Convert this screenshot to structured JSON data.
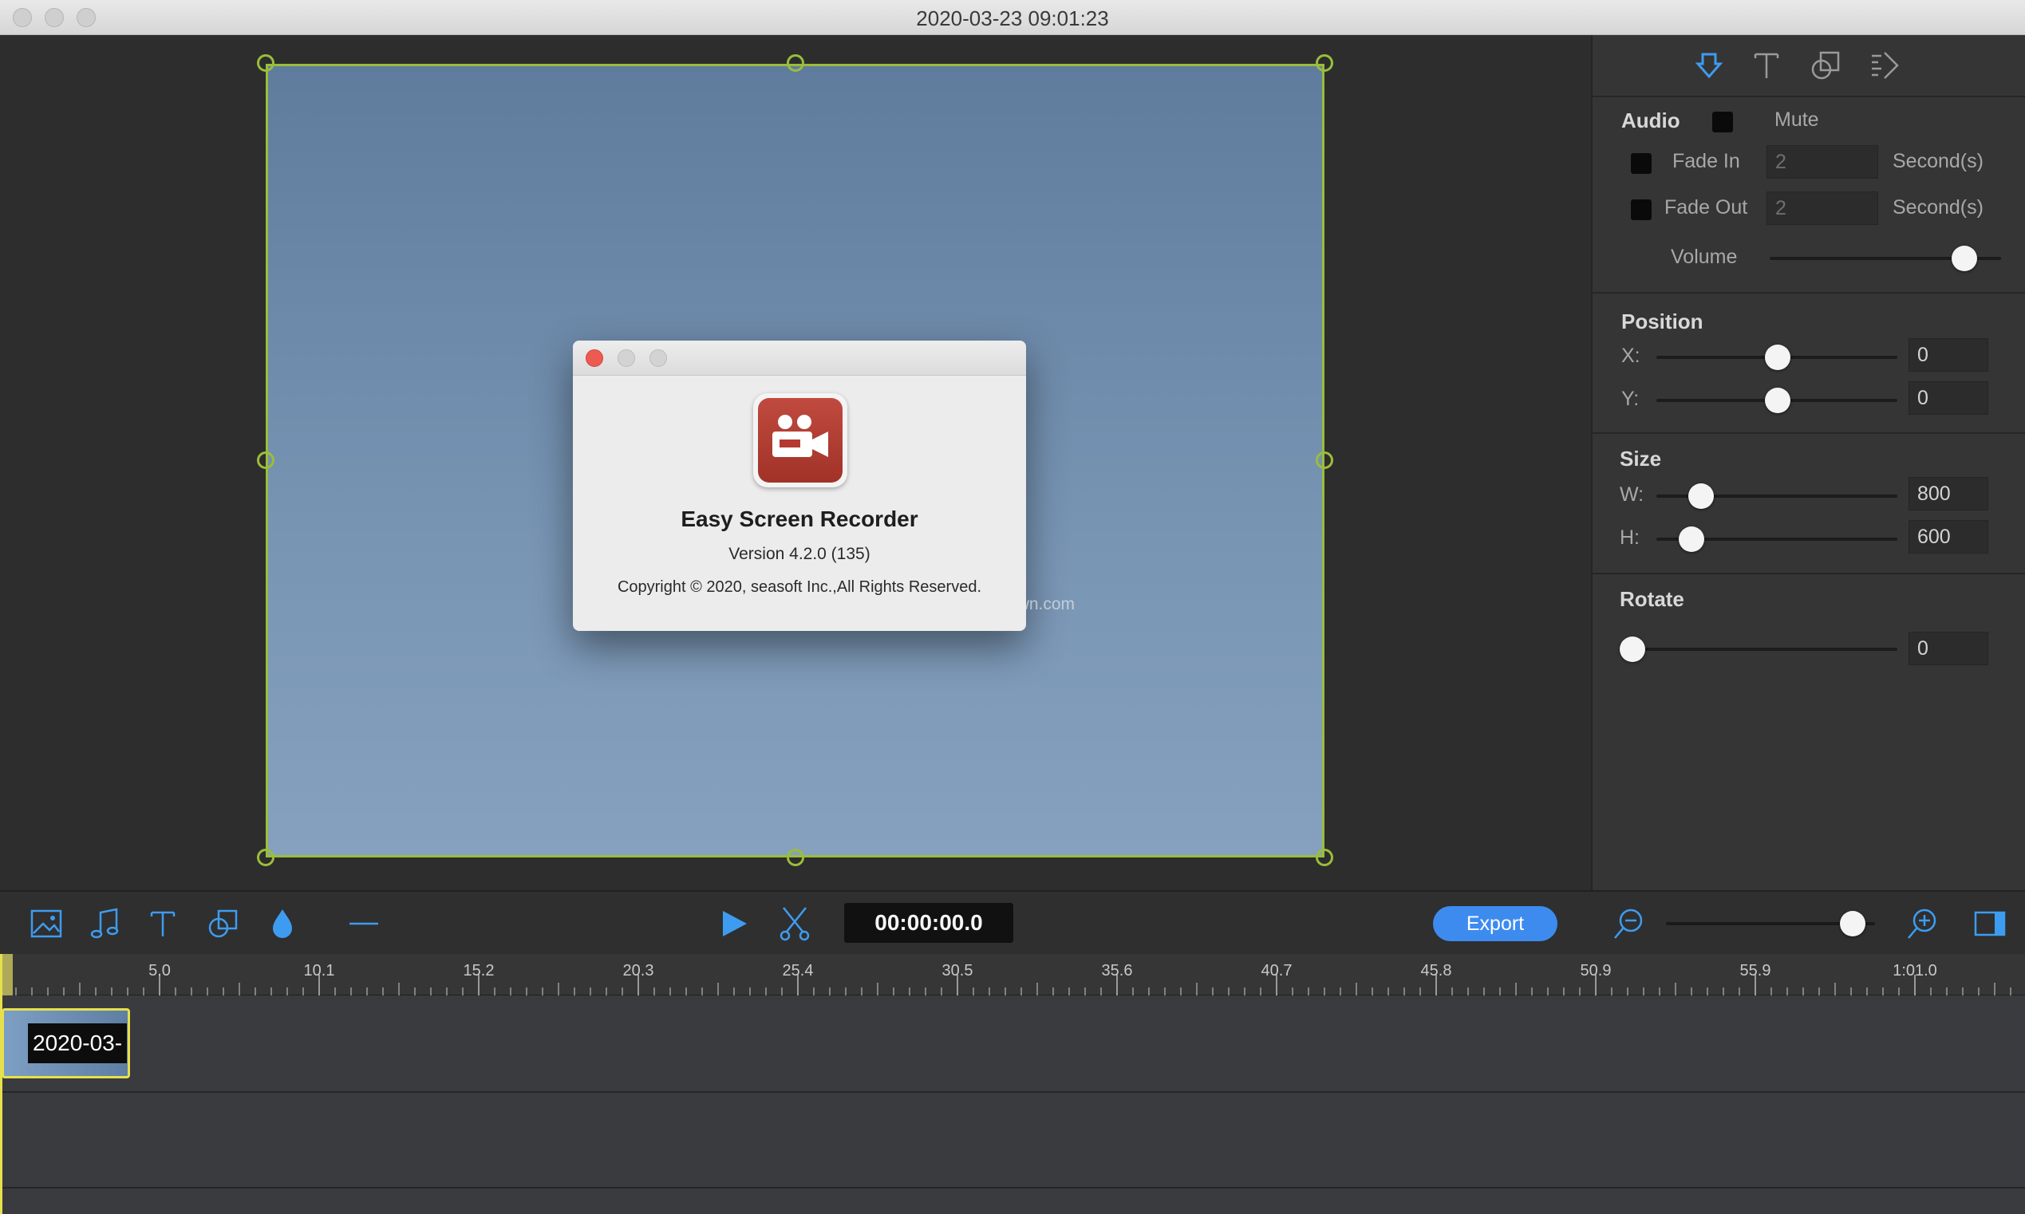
{
  "window": {
    "title": "2020-03-23 09:01:23"
  },
  "about_dialog": {
    "app_name": "Easy Screen Recorder",
    "version": "Version 4.2.0 (135)",
    "copyright": "Copyright © 2020, seasoft Inc.,All Rights Reserved.",
    "watermark": "www.MacDown.com"
  },
  "panel": {
    "tabs": [
      "audio-tab-icon",
      "text-tab-icon",
      "shape-tab-icon",
      "transition-tab-icon"
    ],
    "audio": {
      "title": "Audio",
      "mute_label": "Mute",
      "fade_in_label": "Fade In",
      "fade_in_value": "2",
      "fade_out_label": "Fade Out",
      "fade_out_value": "2",
      "unit": "Second(s)",
      "volume_label": "Volume",
      "volume_level": 0.85
    },
    "position": {
      "title": "Position",
      "x_label": "X:",
      "x_value": "0",
      "y_label": "Y:",
      "y_value": "0"
    },
    "size": {
      "title": "Size",
      "w_label": "W:",
      "w_value": "800",
      "h_label": "H:",
      "h_value": "600"
    },
    "rotate": {
      "title": "Rotate",
      "value": "0"
    }
  },
  "toolbar": {
    "tools": [
      "image-icon",
      "music-icon",
      "text-icon",
      "shape-icon",
      "color-drop-icon",
      "line-icon"
    ],
    "timecode": "00:00:00.0",
    "export_label": "Export",
    "zoom_level": 0.9
  },
  "timeline": {
    "ticks": [
      "5.0",
      "10.1",
      "15.2",
      "20.3",
      "25.4",
      "30.5",
      "35.6",
      "40.7",
      "45.8",
      "50.9",
      "55.9",
      "1:01.0"
    ],
    "clip_label": "2020-03-"
  },
  "colors": {
    "accent": "#3e8bf0",
    "selection": "#9bbd3b",
    "clip_border": "#e6e04b"
  }
}
